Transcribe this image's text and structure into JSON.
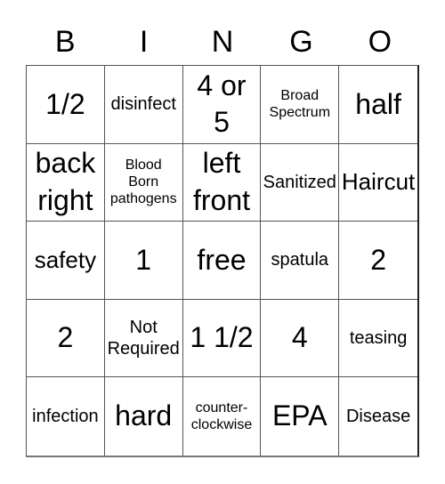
{
  "header": [
    "B",
    "I",
    "N",
    "G",
    "O"
  ],
  "cells": [
    {
      "text": "1/2",
      "size": "s-xl"
    },
    {
      "text": "disinfect",
      "size": "s-m"
    },
    {
      "text": "4 or 5",
      "size": "s-xl"
    },
    {
      "text": "Broad Spectrum",
      "size": "s-s"
    },
    {
      "text": "half",
      "size": "s-xl"
    },
    {
      "text": "back right",
      "size": "s-xl"
    },
    {
      "text": "Blood Born pathogens",
      "size": "s-s"
    },
    {
      "text": "left front",
      "size": "s-xl"
    },
    {
      "text": "Sanitized",
      "size": "s-m"
    },
    {
      "text": "Haircut",
      "size": "s-l"
    },
    {
      "text": "safety",
      "size": "s-l"
    },
    {
      "text": "1",
      "size": "s-xl"
    },
    {
      "text": "free",
      "size": "s-xl"
    },
    {
      "text": "spatula",
      "size": "s-m"
    },
    {
      "text": "2",
      "size": "s-xl"
    },
    {
      "text": "2",
      "size": "s-xl"
    },
    {
      "text": "Not Required",
      "size": "s-m"
    },
    {
      "text": "1 1/2",
      "size": "s-xl"
    },
    {
      "text": "4",
      "size": "s-xl"
    },
    {
      "text": "teasing",
      "size": "s-m"
    },
    {
      "text": "infection",
      "size": "s-m"
    },
    {
      "text": "hard",
      "size": "s-xl"
    },
    {
      "text": "counter-clockwise",
      "size": "s-s"
    },
    {
      "text": "EPA",
      "size": "s-xl"
    },
    {
      "text": "Disease",
      "size": "s-m"
    }
  ]
}
